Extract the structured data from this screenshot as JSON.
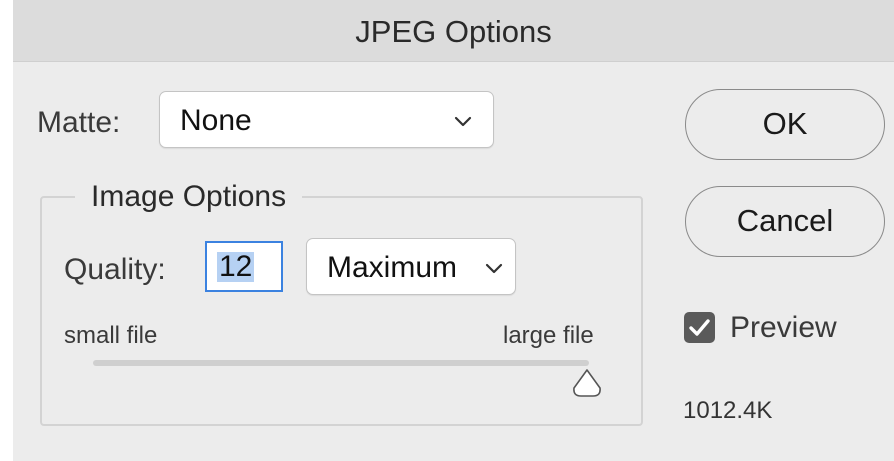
{
  "dialog": {
    "title": "JPEG Options"
  },
  "matte": {
    "label": "Matte:",
    "value": "None"
  },
  "image_options": {
    "group_title": "Image Options",
    "quality_label": "Quality:",
    "quality_value": "12",
    "quality_preset": "Maximum",
    "slider_min_label": "small file",
    "slider_max_label": "large file",
    "slider_level_fraction": 1.0
  },
  "buttons": {
    "ok": "OK",
    "cancel": "Cancel"
  },
  "preview": {
    "label": "Preview",
    "checked": true
  },
  "file_size": "1012.4K",
  "icons": {
    "popup_arrow": "chevron-down-icon",
    "checkbox_mark": "checkmark-icon",
    "slider_handle": "triangle-slider-thumb"
  }
}
